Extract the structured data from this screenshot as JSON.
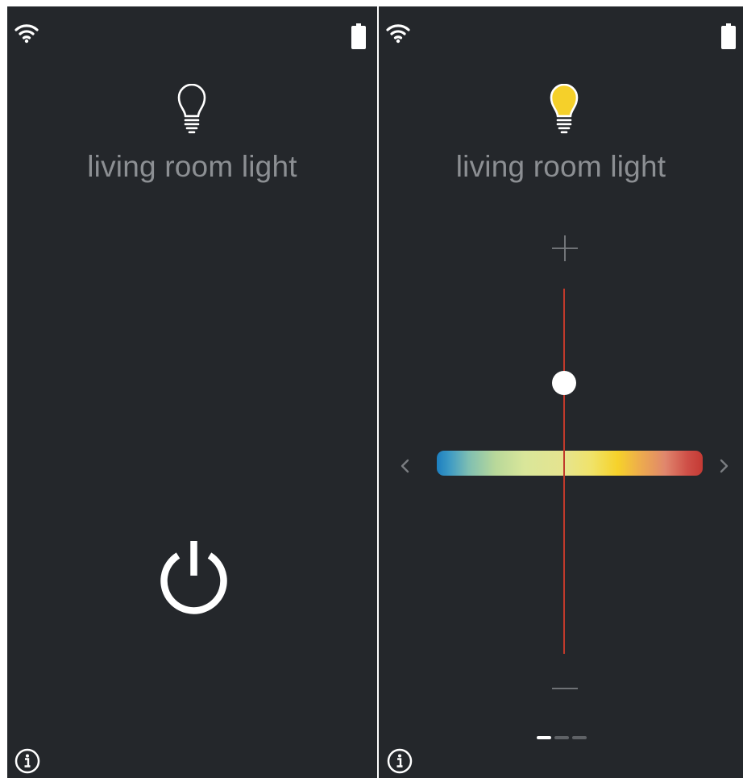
{
  "colors": {
    "background": "#24272b",
    "divider": "#ffffff",
    "title_text": "#8c8f93",
    "icon_white": "#ffffff",
    "bulb_on": "#f5d02a",
    "slider_line": "#c0392b",
    "control_gray": "#7a7d81"
  },
  "screens": [
    {
      "id": "off",
      "status_bar": {
        "wifi_icon": "wifi-icon",
        "battery_icon": "battery-icon"
      },
      "device": {
        "name": "living room light",
        "icon": "lightbulb-outline-icon",
        "state": "off"
      },
      "power_button": {
        "icon": "power-icon"
      },
      "info_button": {
        "icon": "info-icon"
      }
    },
    {
      "id": "on",
      "status_bar": {
        "wifi_icon": "wifi-icon",
        "battery_icon": "battery-icon"
      },
      "device": {
        "name": "living room light",
        "icon": "lightbulb-filled-icon",
        "state": "on"
      },
      "brightness_control": {
        "increase_icon": "plus-icon",
        "decrease_icon": "minus-icon",
        "level": 0.78
      },
      "color_temperature_control": {
        "prev_icon": "chevron-left-icon",
        "next_icon": "chevron-right-icon",
        "position": 0.48,
        "gradient": [
          "#1c7fc0",
          "#b8d89a",
          "#e6e48f",
          "#f6d22a",
          "#e0866d",
          "#c43a34"
        ]
      },
      "pager": {
        "count": 3,
        "active_index": 0
      },
      "info_button": {
        "icon": "info-icon"
      }
    }
  ]
}
